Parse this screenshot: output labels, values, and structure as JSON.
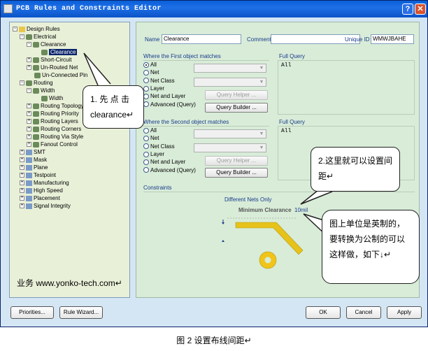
{
  "window": {
    "title": "PCB Rules and Constraints Editor",
    "help_glyph": "?",
    "close_glyph": "✕"
  },
  "tree": {
    "items": [
      {
        "label": "Design Rules",
        "expander": "−"
      },
      {
        "label": "Electrical",
        "expander": "−"
      },
      {
        "label": "Clearance",
        "expander": "−"
      },
      {
        "label": "Clearance",
        "expander": ""
      },
      {
        "label": "Short-Circuit",
        "expander": "+"
      },
      {
        "label": "Un-Routed Net",
        "expander": "+"
      },
      {
        "label": "Un-Connected Pin",
        "expander": ""
      },
      {
        "label": "Routing",
        "expander": "−"
      },
      {
        "label": "Width",
        "expander": "−"
      },
      {
        "label": "Width",
        "expander": ""
      },
      {
        "label": "Routing Topology",
        "expander": "+"
      },
      {
        "label": "Routing Priority",
        "expander": "+"
      },
      {
        "label": "Routing Layers",
        "expander": "+"
      },
      {
        "label": "Routing Corners",
        "expander": "+"
      },
      {
        "label": "Routing Via Style",
        "expander": "+"
      },
      {
        "label": "Fanout Control",
        "expander": "+"
      },
      {
        "label": "SMT",
        "expander": "+"
      },
      {
        "label": "Mask",
        "expander": "+"
      },
      {
        "label": "Plane",
        "expander": "+"
      },
      {
        "label": "Testpoint",
        "expander": "+"
      },
      {
        "label": "Manufacturing",
        "expander": "+"
      },
      {
        "label": "High Speed",
        "expander": "+"
      },
      {
        "label": "Placement",
        "expander": "+"
      },
      {
        "label": "Signal Integrity",
        "expander": "+"
      }
    ]
  },
  "rule": {
    "name_label": "Name",
    "name_value": "Clearance",
    "comment_label": "Comment",
    "comment_value": "",
    "uid_label": "Unique ID",
    "uid_value": "WMWJBAHE"
  },
  "first_match": {
    "title": "Where the First object matches",
    "options": [
      "All",
      "Net",
      "Net Class",
      "Layer",
      "Net and Layer",
      "Advanced (Query)"
    ],
    "selected": "All",
    "query_helper": "Query Helper ...",
    "query_builder": "Query Builder ...",
    "full_query_label": "Full Query",
    "full_query_value": "All"
  },
  "second_match": {
    "title": "Where the Second object matches",
    "options": [
      "All",
      "Net",
      "Net Class",
      "Layer",
      "Net and Layer",
      "Advanced (Query)"
    ],
    "query_helper": "Query Helper ...",
    "query_builder": "Query Builder ...",
    "full_query_label": "Full Query",
    "full_query_value": "All"
  },
  "constraints": {
    "title": "Constraints",
    "different_nets": "Different Nets Only",
    "min_clearance_label": "Minimum Clearance",
    "min_clearance_value": "10mil"
  },
  "buttons": {
    "priorities": "Priorities...",
    "rule_wizard": "Rule Wizard...",
    "ok": "OK",
    "cancel": "Cancel",
    "apply": "Apply"
  },
  "callouts": {
    "step1": "1. 先 点 击 clearance↵",
    "step2": "2.这里就可以设置间距↵",
    "note": "图上单位是英制的，要转换为公制的可以这样做，如下↓↵"
  },
  "watermark": "业务 www.yonko-tech.com↵",
  "caption": "图 2 设置布线间距↵",
  "colors": {
    "title_bar": "#0b54c8",
    "trace": "#e6c21a",
    "pad": "#f0c419",
    "window_bg": "#d4e6f4"
  }
}
